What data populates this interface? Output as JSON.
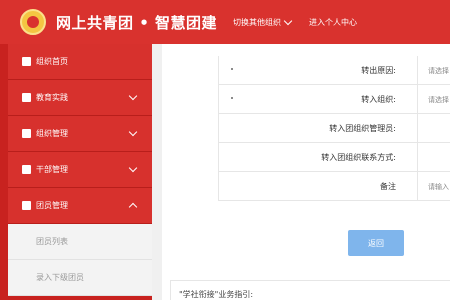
{
  "header": {
    "site_title": "网上共青团 • 智慧团建",
    "switch_org": "切换其他组织",
    "personal_center": "进入个人中心"
  },
  "sidebar": {
    "items": [
      {
        "label": "组织首页",
        "icon": "home-icon"
      },
      {
        "label": "教育实践",
        "icon": "book-icon",
        "chevron": "down"
      },
      {
        "label": "组织管理",
        "icon": "org-icon",
        "chevron": "down"
      },
      {
        "label": "干部管理",
        "icon": "cadre-icon",
        "chevron": "down"
      },
      {
        "label": "团员管理",
        "icon": "members-icon",
        "chevron": "up"
      }
    ],
    "sub_items": [
      {
        "label": "团员列表"
      },
      {
        "label": "录入下级团员"
      }
    ]
  },
  "form": {
    "rows": [
      {
        "label": "转出原因:",
        "value": "请选择",
        "required": true
      },
      {
        "label": "转入组织:",
        "value": "请选择",
        "required": true
      },
      {
        "label": "转入团组织管理员:",
        "value": "",
        "required": false
      },
      {
        "label": "转入团组织联系方式:",
        "value": "",
        "required": false
      },
      {
        "label": "备注",
        "value": "请输入",
        "required": false
      }
    ],
    "back_button": "返回"
  },
  "guide": {
    "title": "\"学社衔接\"业务指引:"
  },
  "colors": {
    "header_bg": "#d9322e",
    "sidebar_bg": "#d7312d",
    "button_bg": "#7fb5ec"
  }
}
